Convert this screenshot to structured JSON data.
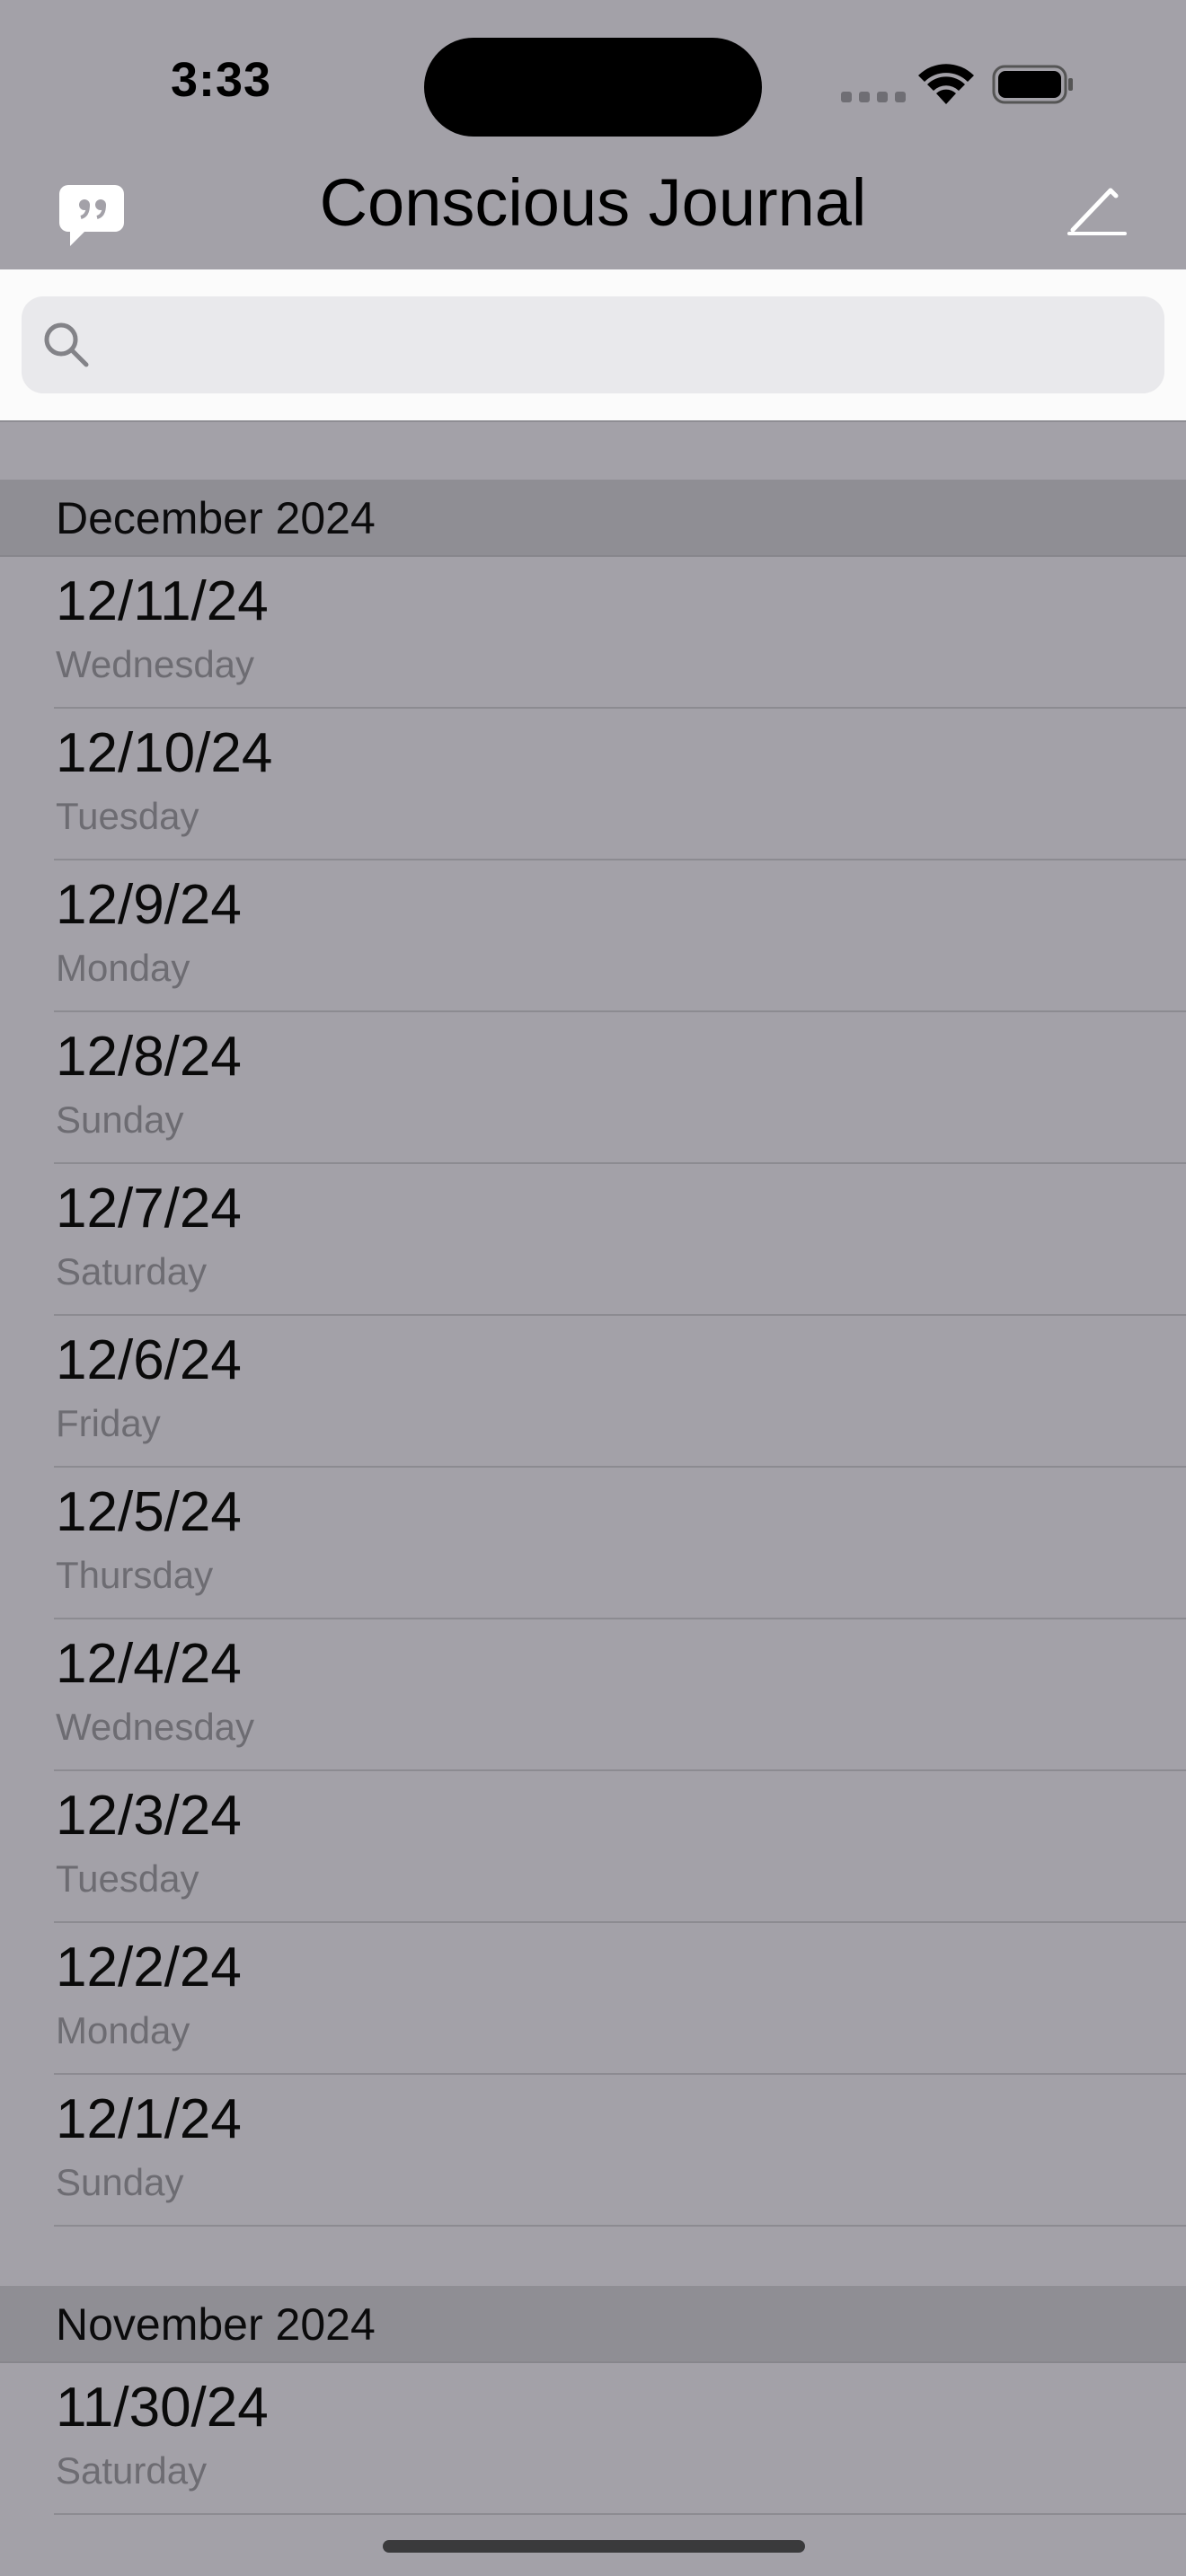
{
  "status": {
    "time": "3:33"
  },
  "navbar": {
    "title": "Conscious Journal"
  },
  "search": {
    "placeholder": ""
  },
  "sections": [
    {
      "title": "December 2024",
      "entries": [
        {
          "date": "12/11/24",
          "day": "Wednesday"
        },
        {
          "date": "12/10/24",
          "day": "Tuesday"
        },
        {
          "date": "12/9/24",
          "day": "Monday"
        },
        {
          "date": "12/8/24",
          "day": "Sunday"
        },
        {
          "date": "12/7/24",
          "day": "Saturday"
        },
        {
          "date": "12/6/24",
          "day": "Friday"
        },
        {
          "date": "12/5/24",
          "day": "Thursday"
        },
        {
          "date": "12/4/24",
          "day": "Wednesday"
        },
        {
          "date": "12/3/24",
          "day": "Tuesday"
        },
        {
          "date": "12/2/24",
          "day": "Monday"
        },
        {
          "date": "12/1/24",
          "day": "Sunday"
        }
      ]
    },
    {
      "title": "November 2024",
      "entries": [
        {
          "date": "11/30/24",
          "day": "Saturday"
        }
      ]
    }
  ],
  "colors": {
    "background": "#a3a1a8",
    "section_header": "#8f8e94",
    "search_panel": "#fbfbfb"
  }
}
